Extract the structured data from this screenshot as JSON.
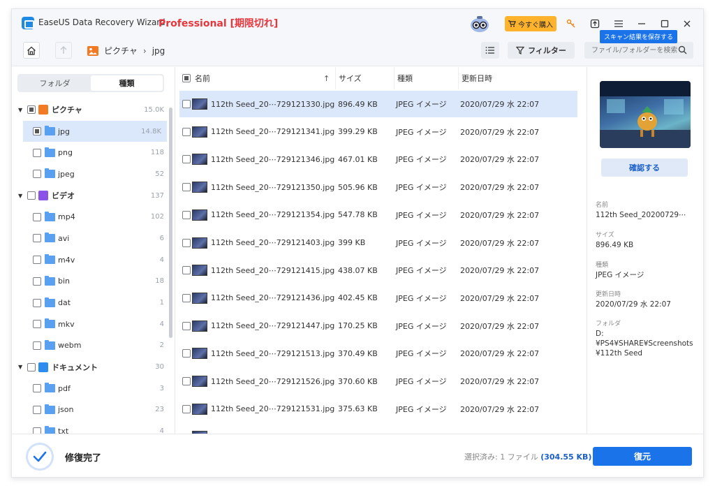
{
  "titlebar": {
    "app_name": "EaseUS Data Recovery Wizard",
    "edition": "Professional [期限切れ]",
    "buy_label": "今すぐ購入",
    "tooltip": "スキャン結果を保存する"
  },
  "toolbar": {
    "breadcrumb": [
      "ピクチャ",
      "jpg"
    ],
    "filter_label": "フィルター",
    "search_placeholder": "ファイル/フォルダーを検索"
  },
  "sidebar": {
    "tabs": [
      "フォルダ",
      "種類"
    ],
    "active_tab": "種類",
    "tree": [
      {
        "label": "ピクチャ",
        "count": "15.0K",
        "level": 0,
        "icon": "picture-icon",
        "color": "#f27a24"
      },
      {
        "label": "jpg",
        "count": "14.8K",
        "level": 1,
        "selected": true
      },
      {
        "label": "png",
        "count": "118",
        "level": 1
      },
      {
        "label": "jpeg",
        "count": "52",
        "level": 1
      },
      {
        "label": "ビデオ",
        "count": "137",
        "level": 0,
        "icon": "video-icon",
        "color": "#8b52e8"
      },
      {
        "label": "mp4",
        "count": "102",
        "level": 1
      },
      {
        "label": "avi",
        "count": "6",
        "level": 1
      },
      {
        "label": "m4v",
        "count": "4",
        "level": 1
      },
      {
        "label": "bin",
        "count": "18",
        "level": 1
      },
      {
        "label": "dat",
        "count": "1",
        "level": 1
      },
      {
        "label": "mkv",
        "count": "4",
        "level": 1
      },
      {
        "label": "webm",
        "count": "2",
        "level": 1
      },
      {
        "label": "ドキュメント",
        "count": "30",
        "level": 0,
        "icon": "document-icon",
        "color": "#2d8cf0"
      },
      {
        "label": "pdf",
        "count": "3",
        "level": 1
      },
      {
        "label": "json",
        "count": "23",
        "level": 1
      },
      {
        "label": "txt",
        "count": "4",
        "level": 1
      }
    ]
  },
  "filelist": {
    "headers": {
      "name": "名前",
      "size": "サイズ",
      "type": "種類",
      "date": "更新日時"
    },
    "rows": [
      {
        "name": "112th Seed_20⋯729121330.jpg",
        "size": "896.49 KB",
        "type": "JPEG イメージ",
        "date": "2020/07/29 水 22:07",
        "selected": true
      },
      {
        "name": "112th Seed_20⋯729121341.jpg",
        "size": "399.29 KB",
        "type": "JPEG イメージ",
        "date": "2020/07/29 水 22:07"
      },
      {
        "name": "112th Seed_20⋯729121346.jpg",
        "size": "467.01 KB",
        "type": "JPEG イメージ",
        "date": "2020/07/29 水 22:07"
      },
      {
        "name": "112th Seed_20⋯729121350.jpg",
        "size": "505.96 KB",
        "type": "JPEG イメージ",
        "date": "2020/07/29 水 22:07"
      },
      {
        "name": "112th Seed_20⋯729121354.jpg",
        "size": "547.78 KB",
        "type": "JPEG イメージ",
        "date": "2020/07/29 水 22:07"
      },
      {
        "name": "112th Seed_20⋯729121403.jpg",
        "size": "399 KB",
        "type": "JPEG イメージ",
        "date": "2020/07/29 水 22:07"
      },
      {
        "name": "112th Seed_20⋯729121415.jpg",
        "size": "438.07 KB",
        "type": "JPEG イメージ",
        "date": "2020/07/29 水 22:07"
      },
      {
        "name": "112th Seed_20⋯729121436.jpg",
        "size": "402.45 KB",
        "type": "JPEG イメージ",
        "date": "2020/07/29 水 22:07"
      },
      {
        "name": "112th Seed_20⋯729121447.jpg",
        "size": "170.25 KB",
        "type": "JPEG イメージ",
        "date": "2020/07/29 水 22:07"
      },
      {
        "name": "112th Seed_20⋯729121513.jpg",
        "size": "370.49 KB",
        "type": "JPEG イメージ",
        "date": "2020/07/29 水 22:07"
      },
      {
        "name": "112th Seed_20⋯729121526.jpg",
        "size": "370.60 KB",
        "type": "JPEG イメージ",
        "date": "2020/07/29 水 22:07"
      },
      {
        "name": "112th Seed_20⋯729121531.jpg",
        "size": "375.63 KB",
        "type": "JPEG イメージ",
        "date": "2020/07/29 水 22:07"
      }
    ]
  },
  "preview": {
    "confirm_label": "確認する",
    "fields": [
      {
        "label": "名前",
        "value": "112th Seed_20200729⋯"
      },
      {
        "label": "サイズ",
        "value": "896.49 KB"
      },
      {
        "label": "種類",
        "value": "JPEG イメージ"
      },
      {
        "label": "更新日時",
        "value": "2020/07/29 水 22:07"
      },
      {
        "label": "フォルダ",
        "value": "D:\n¥PS4¥SHARE¥Screenshots¥112th Seed"
      }
    ]
  },
  "bottom": {
    "status": "修復完了",
    "selection_prefix": "選択済み: 1 ファイル",
    "selection_size": "(304.55 KB)",
    "recover_label": "復元"
  },
  "colors": {
    "accent": "#1a73e8",
    "edition": "#e8363d",
    "buy": "#ffb32d",
    "selected_row": "#dbe8fb"
  }
}
